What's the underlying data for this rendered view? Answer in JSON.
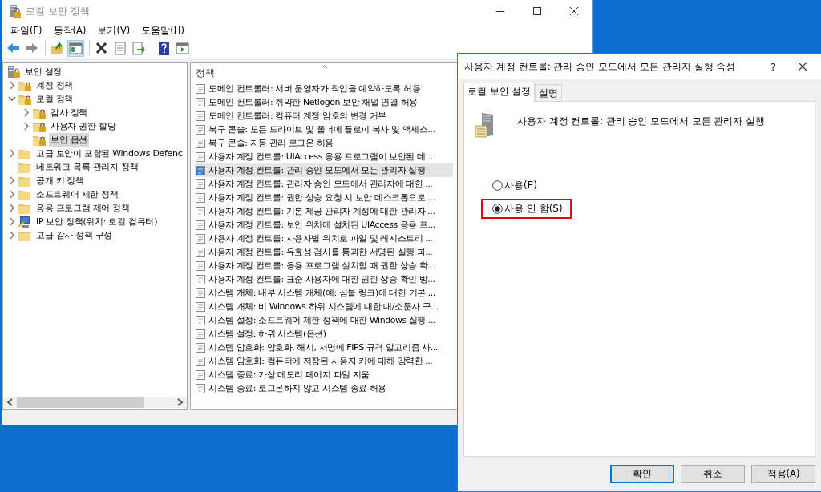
{
  "main_window": {
    "title": "로컬 보안 정책",
    "menu": [
      "파일(F)",
      "동작(A)",
      "보기(V)",
      "도움말(H)"
    ],
    "toolbar": [
      {
        "kind": "back",
        "pressed": false
      },
      {
        "kind": "forward",
        "pressed": false
      },
      {
        "kind": "sep"
      },
      {
        "kind": "up",
        "pressed": false
      },
      {
        "kind": "tree",
        "pressed": true
      },
      {
        "kind": "sep"
      },
      {
        "kind": "delete",
        "pressed": false
      },
      {
        "kind": "properties",
        "pressed": false
      },
      {
        "kind": "export",
        "pressed": false
      },
      {
        "kind": "sep"
      },
      {
        "kind": "help",
        "pressed": false
      },
      {
        "kind": "pane",
        "pressed": false
      }
    ],
    "tree": [
      {
        "label": "보안 설정",
        "kind": "computer",
        "selected": false,
        "children": [
          {
            "label": "계정 정책",
            "kind": "locked",
            "expanded": false,
            "selected": false
          },
          {
            "label": "로컬 정책",
            "kind": "locked",
            "expanded": true,
            "selected": false,
            "children": [
              {
                "label": "감사 정책",
                "kind": "locked",
                "expanded": false,
                "selected": false
              },
              {
                "label": "사용자 권한 할당",
                "kind": "locked",
                "expanded": false,
                "selected": false
              },
              {
                "label": "보안 옵션",
                "kind": "locked",
                "selected": true
              }
            ]
          },
          {
            "label": "고급 보안이 포함된 Windows Defenc",
            "kind": "folder",
            "expanded": false,
            "selected": false
          },
          {
            "label": "네트워크 목록 관리자 정책",
            "kind": "folder",
            "selected": false
          },
          {
            "label": "공개 키 정책",
            "kind": "folder",
            "expanded": false,
            "selected": false
          },
          {
            "label": "소프트웨어 제한 정책",
            "kind": "folder",
            "expanded": false,
            "selected": false
          },
          {
            "label": "응용 프로그램 제어 정책",
            "kind": "folder",
            "expanded": false,
            "selected": false
          },
          {
            "label": "IP 보안 정책(위치: 로컬 컴퓨터)",
            "kind": "ip",
            "expanded": false,
            "selected": false
          },
          {
            "label": "고급 감사 정책 구성",
            "kind": "folder",
            "expanded": false,
            "selected": false
          }
        ]
      }
    ],
    "list": {
      "column": "정책",
      "rows": [
        {
          "label": "도메인 컨트롤러: 서버 운영자가 작업을 예약하도록 허용",
          "selected": false
        },
        {
          "label": "도메인 컨트롤러: 취약한 Netlogon 보안 채널 연결 허용",
          "selected": false
        },
        {
          "label": "도메인 컨트롤러: 컴퓨터 계정 암호의 변경 거부",
          "selected": false
        },
        {
          "label": "복구 콘솔: 모든 드라이브 및 폴더에 플로피 복사 및 액세스...",
          "selected": false
        },
        {
          "label": "복구 콘솔: 자동 관리 로그온 허용",
          "selected": false
        },
        {
          "label": "사용자 계정 컨트롤: UIAccess 응용 프로그램이 보안된 데...",
          "selected": false
        },
        {
          "label": "사용자 계정 컨트롤: 관리 승인 모드에서 모든 관리자 실행",
          "selected": true
        },
        {
          "label": "사용자 계정 컨트롤: 관리자 승인 모드에서 관리자에 대한 ...",
          "selected": false
        },
        {
          "label": "사용자 계정 컨트롤: 권한 상승 요청 시 보안 데스크톱으로 ...",
          "selected": false
        },
        {
          "label": "사용자 계정 컨트롤: 기본 제공 관리자 계정에 대한 관리자 ...",
          "selected": false
        },
        {
          "label": "사용자 계정 컨트롤: 보안 위치에 설치된 UIAccess 응용 프...",
          "selected": false
        },
        {
          "label": "사용자 계정 컨트롤: 사용자별 위치로 파일 및 레지스트리 ...",
          "selected": false
        },
        {
          "label": "사용자 계정 컨트롤: 유효성 검사를 통과한 서명된 실행 파...",
          "selected": false
        },
        {
          "label": "사용자 계정 컨트롤: 응용 프로그램 설치할 때 권한 상승 확...",
          "selected": false
        },
        {
          "label": "사용자 계정 컨트롤: 표준 사용자에 대한 권한 상승 확인 방...",
          "selected": false
        },
        {
          "label": "시스템 개체: 내부 시스템 개체(예: 심볼 링크)에 대한 기본 ...",
          "selected": false
        },
        {
          "label": "시스템 개체: 비 Windows 하위 시스템에 대한 대/소문자 구...",
          "selected": false
        },
        {
          "label": "시스템 설정: 소프트웨어 제한 정책에 대한 Windows 실행 ...",
          "selected": false
        },
        {
          "label": "시스템 설정: 하위 시스템(옵션)",
          "selected": false
        },
        {
          "label": "시스템 암호화: 암호화, 해시, 서명에 FIPS 규격 알고리즘 사...",
          "selected": false
        },
        {
          "label": "시스템 암호화: 컴퓨터에 저장된 사용자 키에 대해 강력한 ...",
          "selected": false
        },
        {
          "label": "시스템 종료: 가상 메모리 페이지 파일 지움",
          "selected": false
        },
        {
          "label": "시스템 종료: 로그온하지 않고 시스템 종료 허용",
          "selected": false
        }
      ]
    }
  },
  "dialog": {
    "title": "사용자 계정 컨트롤: 관리 승인 모드에서 모든 관리자 실행 속성",
    "help": "?",
    "tabs": [
      {
        "label": "로컬 보안 설정",
        "selected": true
      },
      {
        "label": "설명",
        "selected": false
      }
    ],
    "policy_name": "사용자 계정 컨트롤: 관리 승인 모드에서 모든 관리자 실행",
    "options": [
      {
        "label": "사용(E)",
        "selected": false,
        "highlighted": false
      },
      {
        "label": "사용 안 함(S)",
        "selected": true,
        "highlighted": true
      }
    ],
    "buttons": [
      {
        "label": "확인",
        "default": true
      },
      {
        "label": "취소",
        "default": false
      },
      {
        "label": "적용(A)",
        "default": false
      }
    ]
  }
}
